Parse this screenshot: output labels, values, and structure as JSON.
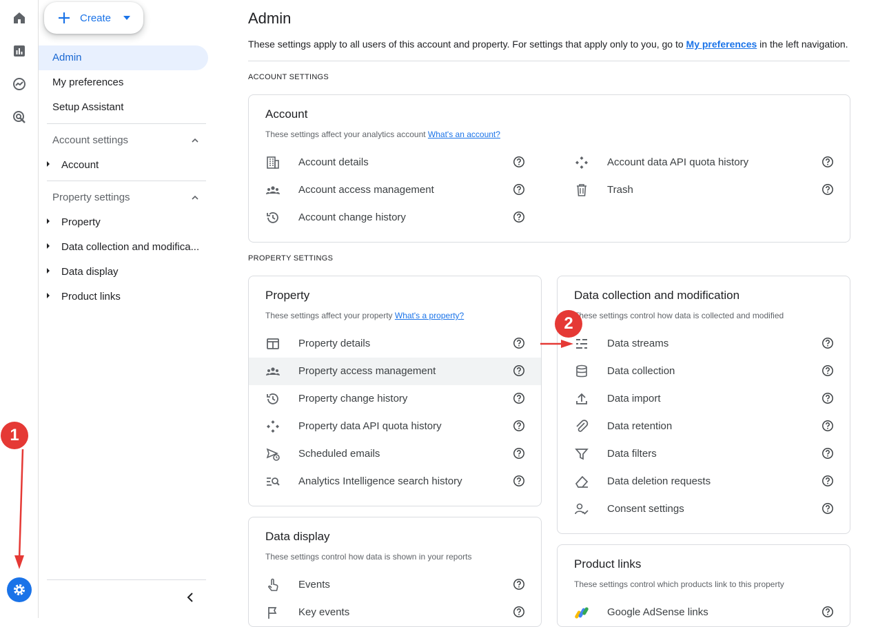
{
  "create": {
    "label": "Create"
  },
  "nav": {
    "admin": "Admin",
    "prefs": "My preferences",
    "setup": "Setup Assistant",
    "account_settings": "Account settings",
    "account": "Account",
    "property_settings": "Property settings",
    "property": "Property",
    "data_collection": "Data collection and modifica...",
    "data_display": "Data display",
    "product_links": "Product links"
  },
  "main": {
    "title": "Admin",
    "intro_before": "These settings apply to all users of this account and property. For settings that apply only to you, go to ",
    "intro_link": "My preferences",
    "intro_after": " in the left navigation.",
    "account_caption": "ACCOUNT SETTINGS",
    "property_caption": "PROPERTY SETTINGS"
  },
  "account_card": {
    "title": "Account",
    "subtitle": "These settings affect your analytics account ",
    "link": "What's an account?",
    "left": [
      "Account details",
      "Account access management",
      "Account change history"
    ],
    "right": [
      "Account data API quota history",
      "Trash"
    ]
  },
  "property_card": {
    "title": "Property",
    "subtitle": "These settings affect your property ",
    "link": "What's a property?",
    "items": [
      "Property details",
      "Property access management",
      "Property change history",
      "Property data API quota history",
      "Scheduled emails",
      "Analytics Intelligence search history"
    ]
  },
  "datacoll_card": {
    "title": "Data collection and modification",
    "subtitle": "These settings control how data is collected and modified",
    "items": [
      "Data streams",
      "Data collection",
      "Data import",
      "Data retention",
      "Data filters",
      "Data deletion requests",
      "Consent settings"
    ]
  },
  "display_card": {
    "title": "Data display",
    "subtitle": "These settings control how data is shown in your reports",
    "items": [
      "Events",
      "Key events"
    ]
  },
  "links_card": {
    "title": "Product links",
    "subtitle": "These settings control which products link to this property",
    "items": [
      "Google AdSense links"
    ]
  },
  "annotations": {
    "one": "1",
    "two": "2"
  },
  "colors": {
    "accent": "#1a73e8",
    "annotation": "#e53935",
    "active_bg": "#e8f0fe"
  }
}
